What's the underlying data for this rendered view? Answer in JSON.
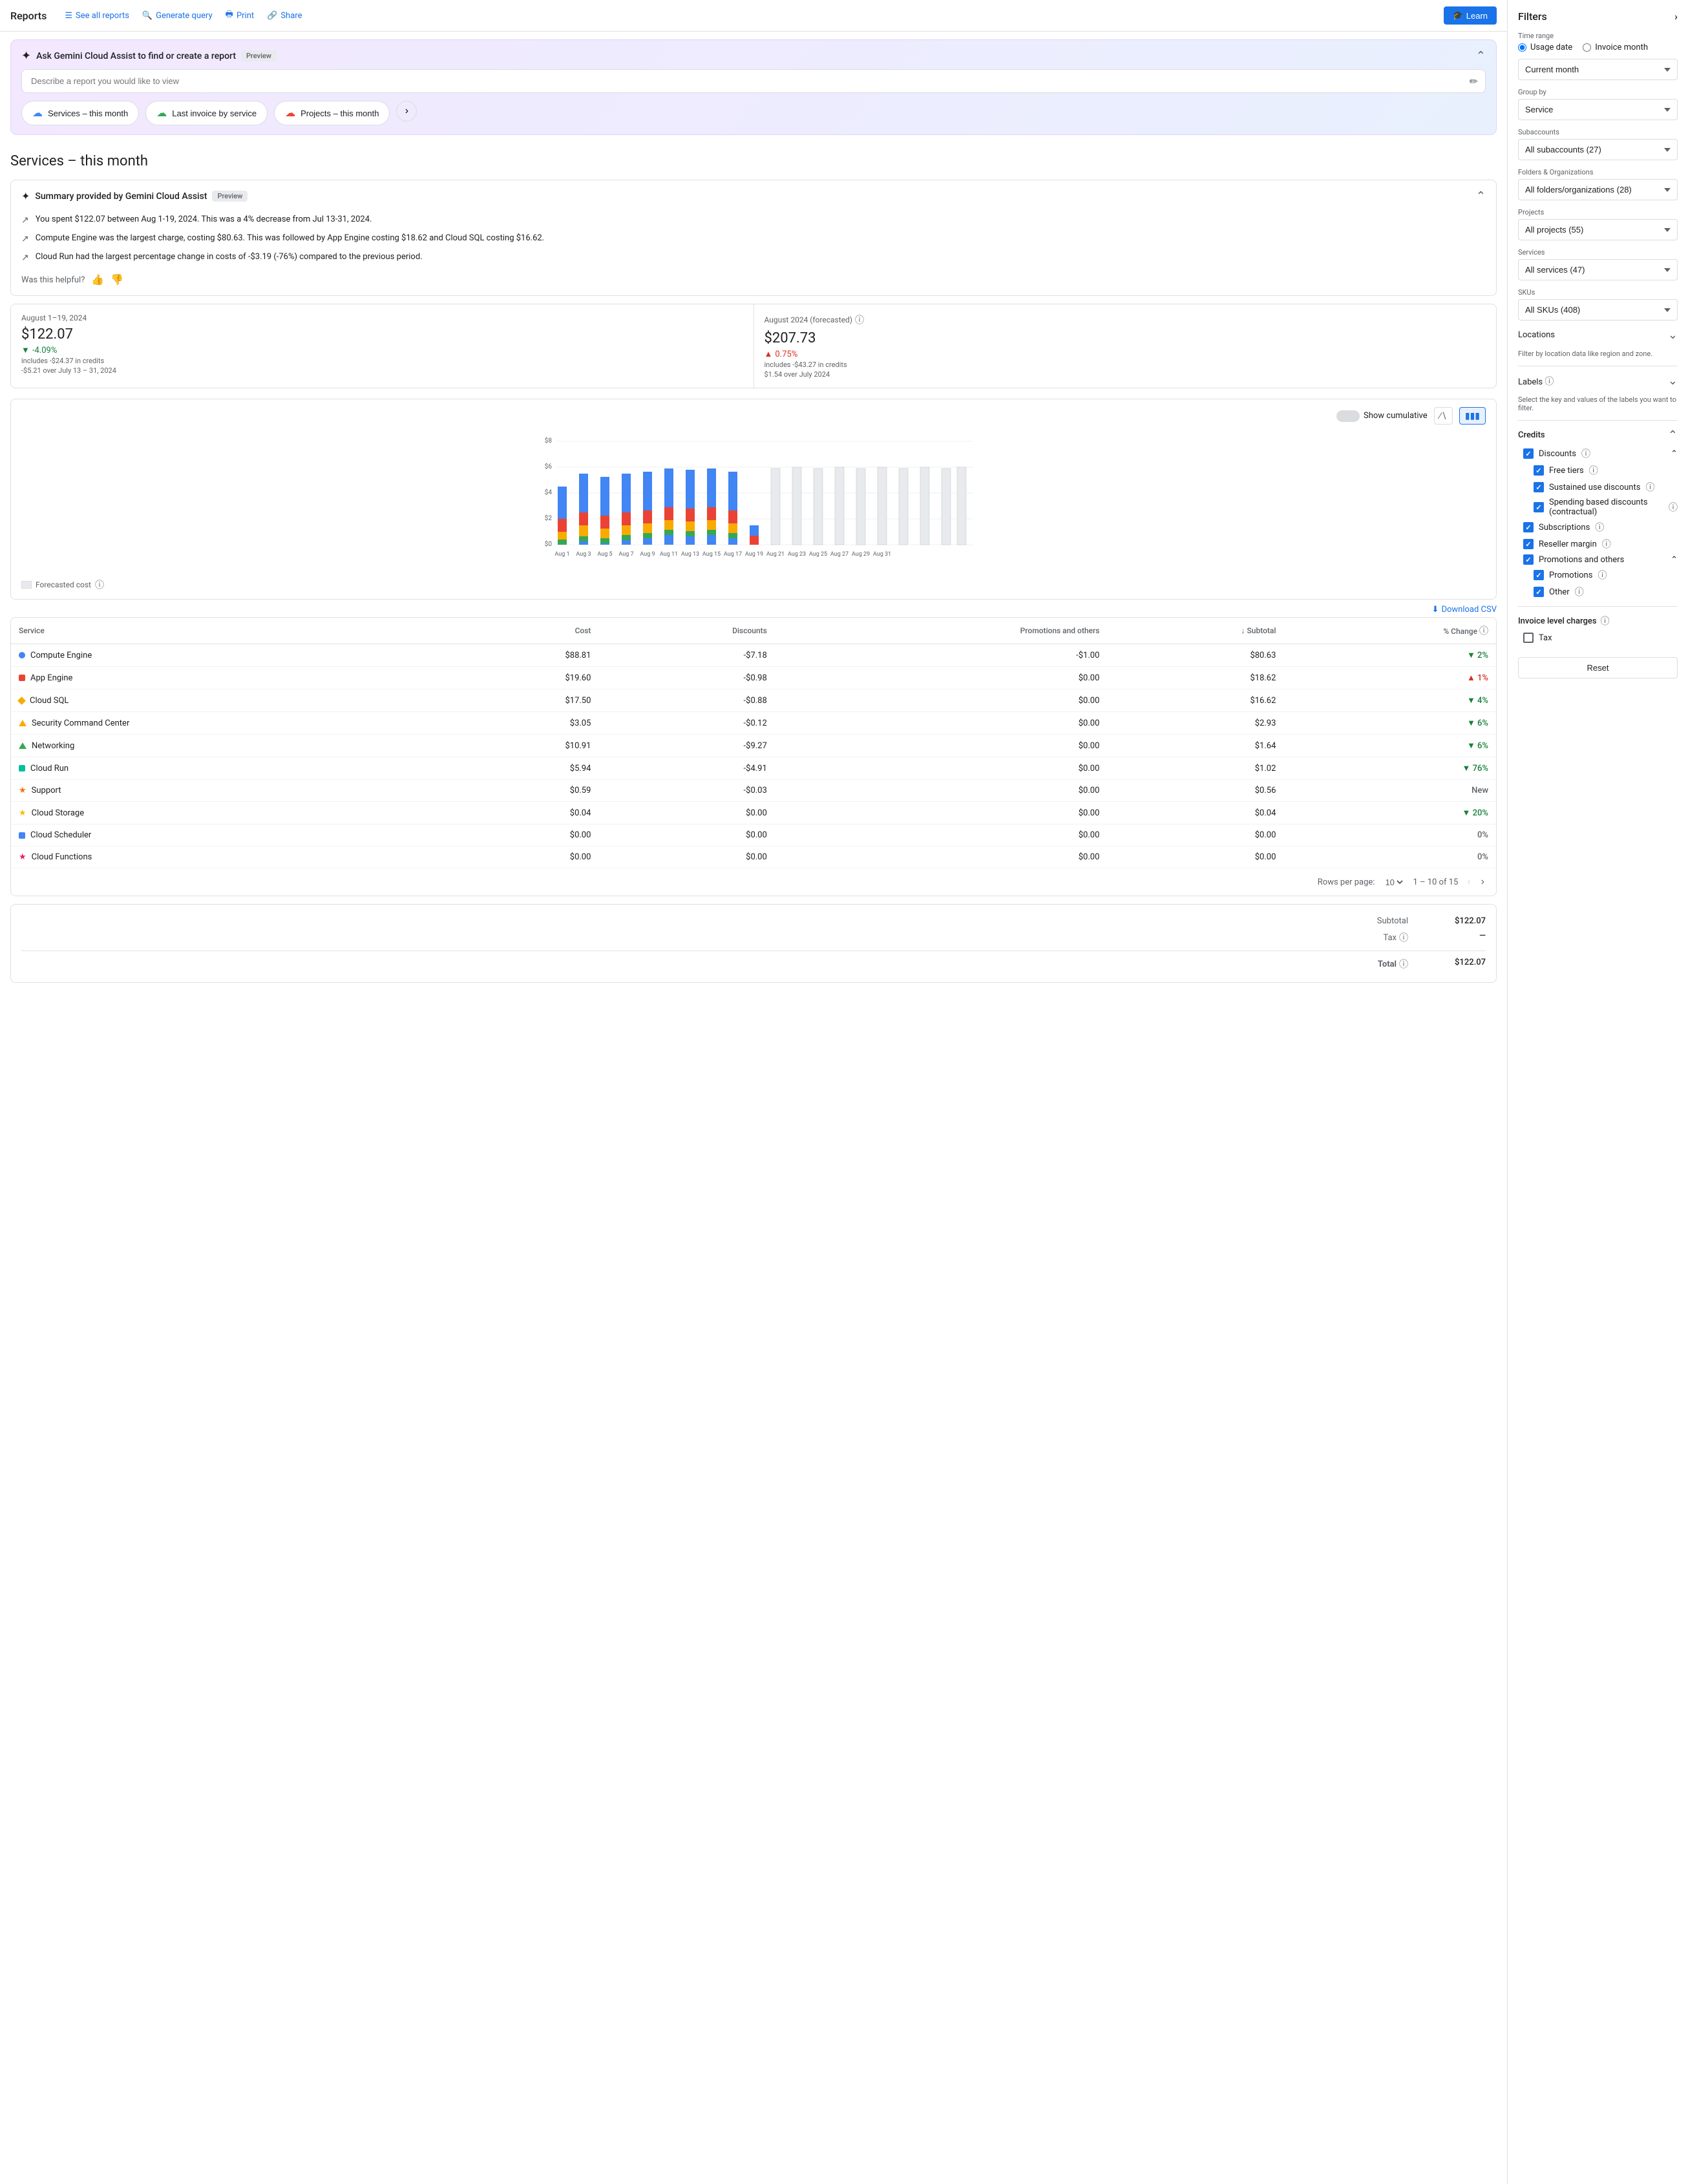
{
  "nav": {
    "title": "Reports",
    "links": [
      {
        "label": "See all reports",
        "icon": "list-icon"
      },
      {
        "label": "Generate query",
        "icon": "search-icon"
      },
      {
        "label": "Print",
        "icon": "print-icon"
      },
      {
        "label": "Share",
        "icon": "share-icon"
      }
    ],
    "learn_label": "Learn"
  },
  "gemini": {
    "title": "Ask Gemini Cloud Assist to find or create a report",
    "preview_badge": "Preview",
    "placeholder": "Describe a report you would like to view",
    "quick_reports": [
      {
        "label": "Services – this month"
      },
      {
        "label": "Last invoice by service"
      },
      {
        "label": "Projects – this month"
      }
    ]
  },
  "page_title": "Services – this month",
  "summary": {
    "title": "Summary provided by Gemini Cloud Assist",
    "preview_badge": "Preview",
    "items": [
      "You spent $122.07 between Aug 1-19, 2024. This was a 4% decrease from Jul 13-31, 2024.",
      "Compute Engine was the largest charge, costing $80.63. This was followed by App Engine costing $18.62 and Cloud SQL costing $16.62.",
      "Cloud Run had the largest percentage change in costs of -$3.19 (-76%) compared to the previous period."
    ],
    "helpful_label": "Was this helpful?"
  },
  "metrics": {
    "current": {
      "label": "August 1–19, 2024",
      "value": "$122.07",
      "sub1": "includes -$24.37 in credits",
      "change_pct": "-4.09%",
      "change_dir": "down",
      "change_sub": "-$5.21 over July 13 – 31, 2024"
    },
    "forecast": {
      "label": "August 2024 (forecasted)",
      "value": "$207.73",
      "sub1": "includes -$43.27 in credits",
      "change_pct": "0.75%",
      "change_dir": "up",
      "change_sub": "$1.54 over July 2024"
    }
  },
  "chart": {
    "y_label": "$8",
    "y_ticks": [
      "$8",
      "$6",
      "$4",
      "$2",
      "$0"
    ],
    "x_labels": [
      "Aug 1",
      "Aug 3",
      "Aug 5",
      "Aug 7",
      "Aug 9",
      "Aug 11",
      "Aug 13",
      "Aug 15",
      "Aug 17",
      "Aug 19",
      "Aug 21",
      "Aug 23",
      "Aug 25",
      "Aug 27",
      "Aug 29",
      "Aug 31"
    ],
    "cumulative_label": "Show cumulative",
    "forecasted_label": "Forecasted cost"
  },
  "table": {
    "download_label": "Download CSV",
    "columns": [
      "Service",
      "Cost",
      "Discounts",
      "Promotions and others",
      "Subtotal",
      "% Change"
    ],
    "rows": [
      {
        "service": "Compute Engine",
        "color": "#4285f4",
        "shape": "circle",
        "cost": "$88.81",
        "discounts": "-$7.18",
        "promotions": "-$1.00",
        "subtotal": "$80.63",
        "change": "2%",
        "change_dir": "down"
      },
      {
        "service": "App Engine",
        "color": "#ea4335",
        "shape": "square",
        "cost": "$19.60",
        "discounts": "-$0.98",
        "promotions": "$0.00",
        "subtotal": "$18.62",
        "change": "1%",
        "change_dir": "up"
      },
      {
        "service": "Cloud SQL",
        "color": "#f9ab00",
        "shape": "diamond",
        "cost": "$17.50",
        "discounts": "-$0.88",
        "promotions": "$0.00",
        "subtotal": "$16.62",
        "change": "4%",
        "change_dir": "down"
      },
      {
        "service": "Security Command Center",
        "color": "#f9ab00",
        "shape": "triangle",
        "cost": "$3.05",
        "discounts": "-$0.12",
        "promotions": "$0.00",
        "subtotal": "$2.93",
        "change": "6%",
        "change_dir": "down"
      },
      {
        "service": "Networking",
        "color": "#34a853",
        "shape": "triangle-up",
        "cost": "$10.91",
        "discounts": "-$9.27",
        "promotions": "$0.00",
        "subtotal": "$1.64",
        "change": "6%",
        "change_dir": "down"
      },
      {
        "service": "Cloud Run",
        "color": "#00bfa5",
        "shape": "square",
        "cost": "$5.94",
        "discounts": "-$4.91",
        "promotions": "$0.00",
        "subtotal": "$1.02",
        "change": "76%",
        "change_dir": "down"
      },
      {
        "service": "Support",
        "color": "#ff6d00",
        "shape": "star",
        "cost": "$0.59",
        "discounts": "-$0.03",
        "promotions": "$0.00",
        "subtotal": "$0.56",
        "change": "New",
        "change_dir": "neutral"
      },
      {
        "service": "Cloud Storage",
        "color": "#fbbc04",
        "shape": "star",
        "cost": "$0.04",
        "discounts": "$0.00",
        "promotions": "$0.00",
        "subtotal": "$0.04",
        "change": "20%",
        "change_dir": "down"
      },
      {
        "service": "Cloud Scheduler",
        "color": "#4285f4",
        "shape": "square",
        "cost": "$0.00",
        "discounts": "$0.00",
        "promotions": "$0.00",
        "subtotal": "$0.00",
        "change": "0%",
        "change_dir": "neutral"
      },
      {
        "service": "Cloud Functions",
        "color": "#e91e63",
        "shape": "star",
        "cost": "$0.00",
        "discounts": "$0.00",
        "promotions": "$0.00",
        "subtotal": "$0.00",
        "change": "0%",
        "change_dir": "neutral"
      }
    ],
    "pagination": {
      "rows_per_page_label": "Rows per page:",
      "rows_per_page": "10",
      "page_info": "1 – 10 of 15"
    }
  },
  "totals": {
    "subtotal_label": "Subtotal",
    "subtotal_value": "$122.07",
    "tax_label": "Tax",
    "tax_value": "—",
    "total_label": "Total",
    "total_value": "$122.07"
  },
  "filters": {
    "title": "Filters",
    "time_range_label": "Time range",
    "usage_date_label": "Usage date",
    "invoice_month_label": "Invoice month",
    "current_month_label": "Current month",
    "group_by_label": "Group by",
    "group_by_value": "Service",
    "subaccounts_label": "Subaccounts",
    "subaccounts_value": "All subaccounts (27)",
    "folders_label": "Folders & Organizations",
    "folders_value": "All folders/organizations (28)",
    "projects_label": "Projects",
    "projects_value": "All projects (55)",
    "services_label": "Services",
    "services_value": "All services (47)",
    "skus_label": "SKUs",
    "skus_value": "All SKUs (408)",
    "locations_label": "Locations",
    "locations_sub": "Filter by location data like region and zone.",
    "labels_label": "Labels",
    "labels_sub": "Select the key and values of the labels you want to filter.",
    "credits": {
      "title": "Credits",
      "discounts_label": "Discounts",
      "free_tiers_label": "Free tiers",
      "sustained_label": "Sustained use discounts",
      "spending_label": "Spending based discounts (contractual)",
      "subscriptions_label": "Subscriptions",
      "reseller_label": "Reseller margin",
      "promotions_label": "Promotions and others",
      "promotions_sub_label": "Promotions",
      "other_label": "Other"
    },
    "invoice_charges_label": "Invoice level charges",
    "tax_label": "Tax",
    "reset_label": "Reset"
  }
}
